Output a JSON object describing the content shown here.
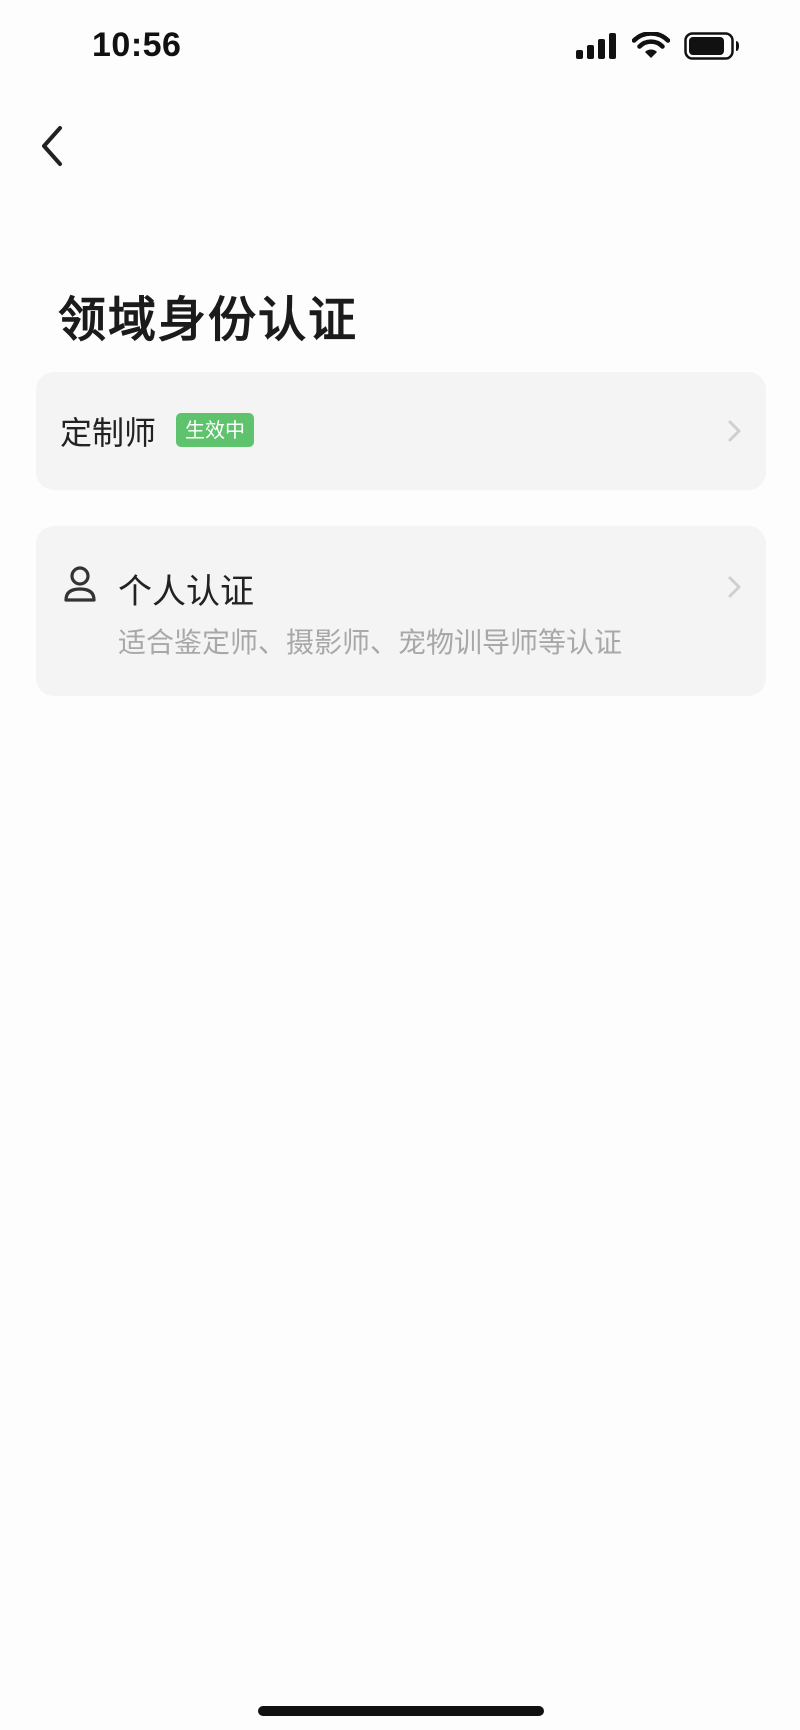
{
  "status_bar": {
    "time": "10:56",
    "icons": [
      "cellular-signal-icon",
      "wifi-icon",
      "battery-icon"
    ]
  },
  "nav": {
    "back_icon": "chevron-left-icon"
  },
  "page": {
    "title": "领域身份认证"
  },
  "cards": [
    {
      "label": "定制师",
      "badge": "生效中",
      "badge_color": "#5fc36e",
      "chevron_icon": "chevron-right-icon"
    },
    {
      "icon": "person-icon",
      "label": "个人认证",
      "description": "适合鉴定师、摄影师、宠物训导师等认证",
      "chevron_icon": "chevron-right-icon"
    }
  ],
  "colors": {
    "background": "#fdfdfd",
    "card_background": "#f4f4f4",
    "muted_text": "#a8a8a8",
    "badge_green": "#5fc36e"
  }
}
